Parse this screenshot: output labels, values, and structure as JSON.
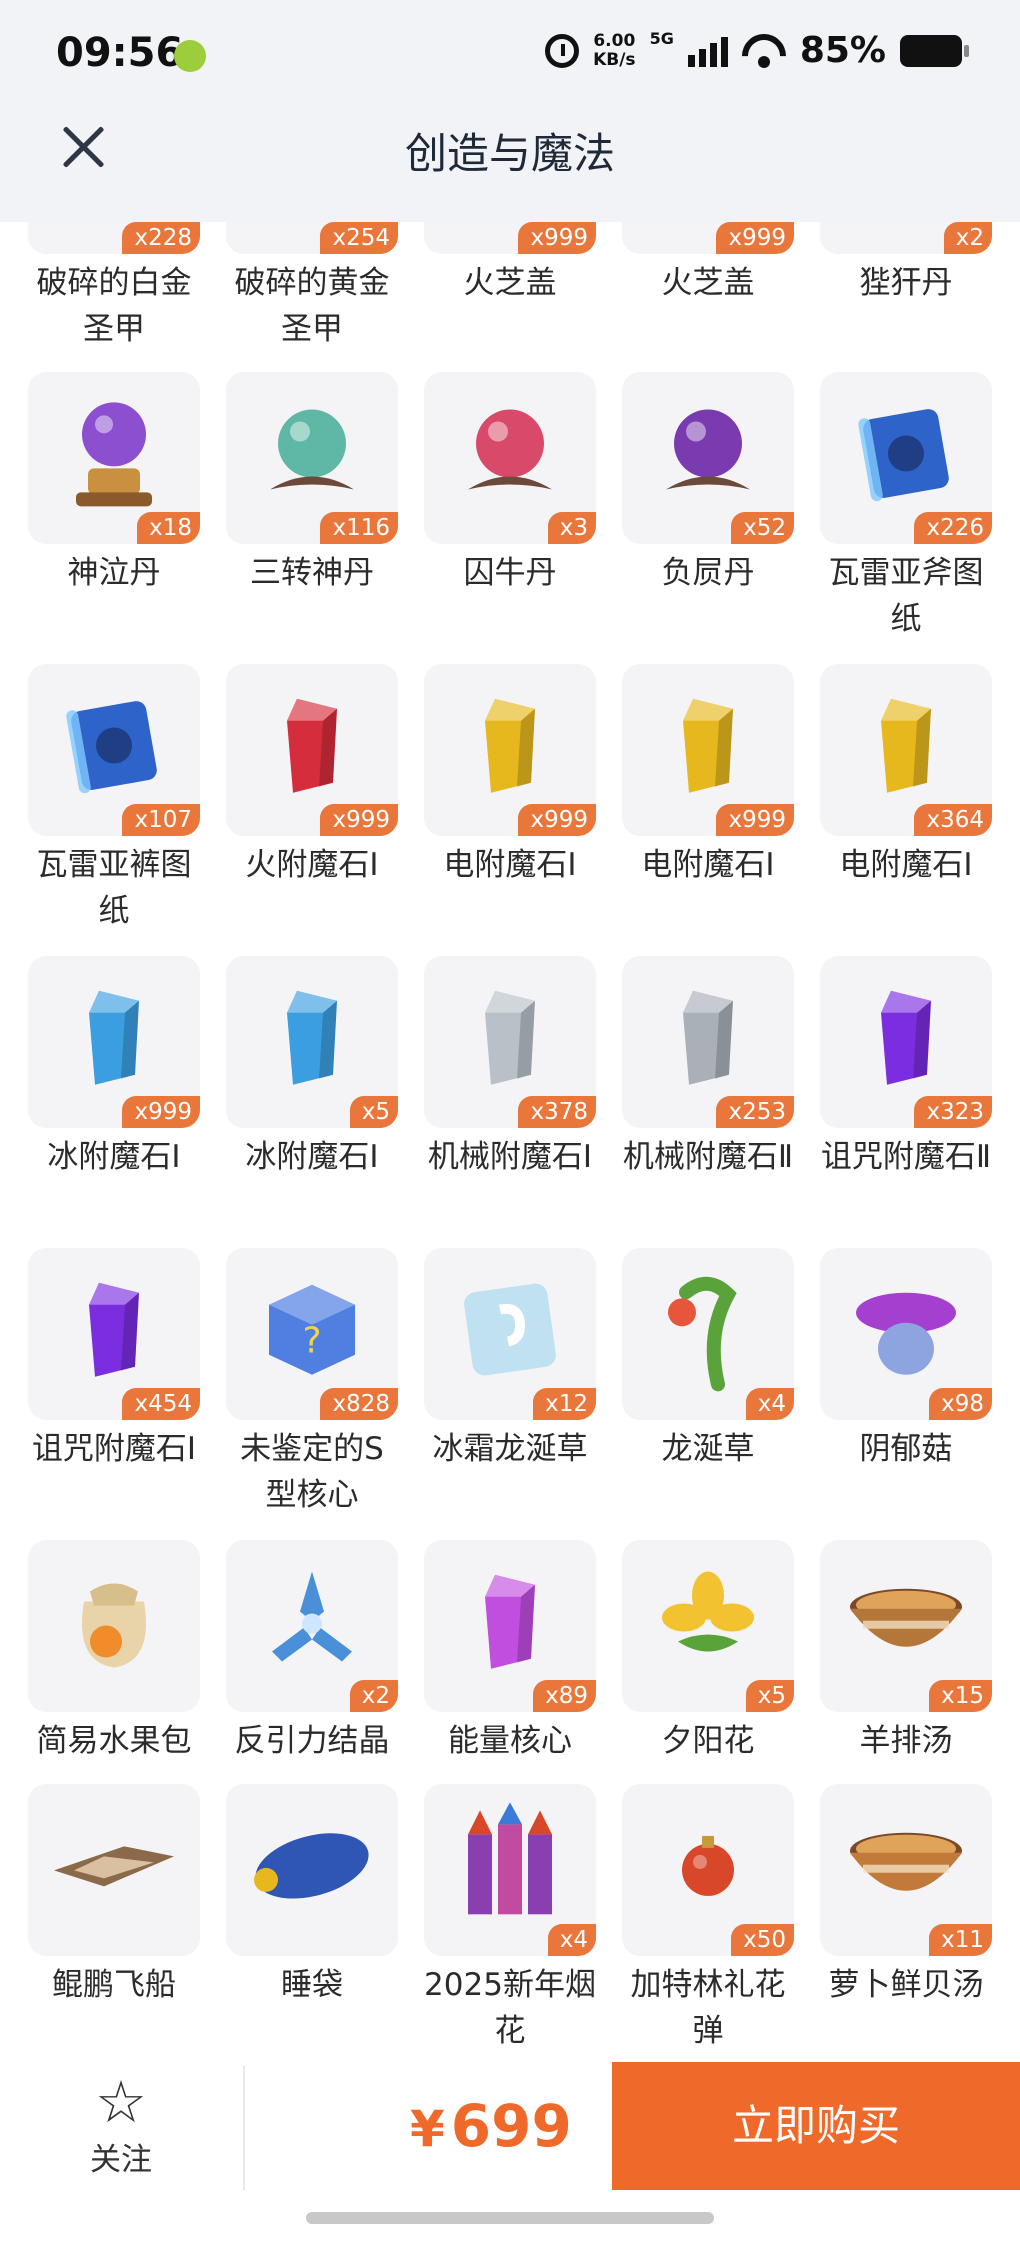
{
  "status_bar": {
    "time": "09:56",
    "speed_value": "6.00",
    "speed_unit": "KB/s",
    "network": "5G",
    "battery": "85%"
  },
  "header": {
    "title": "创造与魔法",
    "close_icon": "close-icon"
  },
  "items": [
    {
      "name": "破碎的白金圣甲",
      "count": "x228",
      "icon": "armor-icon",
      "partial": true
    },
    {
      "name": "破碎的黄金圣甲",
      "count": "x254",
      "icon": "armor-icon",
      "partial": true
    },
    {
      "name": "火芝盖",
      "count": "x999",
      "icon": "mushroom-icon",
      "partial": true
    },
    {
      "name": "火芝盖",
      "count": "x999",
      "icon": "mushroom-icon",
      "partial": true
    },
    {
      "name": "狴犴丹",
      "count": "x2",
      "icon": "pill-icon",
      "partial": true
    },
    {
      "name": "神泣丹",
      "count": "x18",
      "icon": "crystal-ball-icon",
      "color": "#8b4fd0"
    },
    {
      "name": "三转神丹",
      "count": "x116",
      "icon": "orb-icon",
      "color": "#5fb8a6"
    },
    {
      "name": "囚牛丹",
      "count": "x3",
      "icon": "orb-icon",
      "color": "#d94a6a"
    },
    {
      "name": "负屃丹",
      "count": "x52",
      "icon": "orb-icon",
      "color": "#7a3bb0"
    },
    {
      "name": "瓦雷亚斧图纸",
      "count": "x226",
      "icon": "scroll-icon",
      "color": "#2e63c9"
    },
    {
      "name": "瓦雷亚裤图纸",
      "count": "x107",
      "icon": "scroll-icon",
      "color": "#2e63c9"
    },
    {
      "name": "火附魔石Ⅰ",
      "count": "x999",
      "icon": "gem-icon",
      "color": "#d62d3c"
    },
    {
      "name": "电附魔石Ⅰ",
      "count": "x999",
      "icon": "gem-icon",
      "color": "#e6b81e"
    },
    {
      "name": "电附魔石Ⅰ",
      "count": "x999",
      "icon": "gem-icon",
      "color": "#e6b81e"
    },
    {
      "name": "电附魔石Ⅰ",
      "count": "x364",
      "icon": "gem-icon",
      "color": "#e6b81e"
    },
    {
      "name": "冰附魔石Ⅰ",
      "count": "x999",
      "icon": "gem-icon",
      "color": "#3a9ee0"
    },
    {
      "name": "冰附魔石Ⅰ",
      "count": "x5",
      "icon": "gem-icon",
      "color": "#3a9ee0"
    },
    {
      "name": "机械附魔石Ⅰ",
      "count": "x378",
      "icon": "gem-icon",
      "color": "#b9c0c8"
    },
    {
      "name": "机械附魔石Ⅱ",
      "count": "x253",
      "icon": "gem-icon",
      "color": "#a9b0b8"
    },
    {
      "name": "诅咒附魔石Ⅱ",
      "count": "x323",
      "icon": "gem-icon",
      "color": "#7b2ee0"
    },
    {
      "name": "诅咒附魔石Ⅰ",
      "count": "x454",
      "icon": "gem-icon",
      "color": "#7b2ee0"
    },
    {
      "name": "未鉴定的S型核心",
      "count": "x828",
      "icon": "mystery-box-icon",
      "color": "#4f7fe0"
    },
    {
      "name": "冰霜龙涎草",
      "count": "x12",
      "icon": "ice-block-icon",
      "color": "#bfe1f2"
    },
    {
      "name": "龙涎草",
      "count": "x4",
      "icon": "plant-icon",
      "color": "#5aa33a"
    },
    {
      "name": "阴郁菇",
      "count": "x98",
      "icon": "mushroom-icon",
      "color": "#a53fd0"
    },
    {
      "name": "简易水果包",
      "count": "",
      "icon": "bag-icon",
      "color": "#e8d4a8"
    },
    {
      "name": "反引力结晶",
      "count": "x2",
      "icon": "crystal-icon",
      "color": "#4a90d9"
    },
    {
      "name": "能量核心",
      "count": "x89",
      "icon": "gem-icon",
      "color": "#c24ee0"
    },
    {
      "name": "夕阳花",
      "count": "x5",
      "icon": "flower-icon",
      "color": "#f2c230"
    },
    {
      "name": "羊排汤",
      "count": "x15",
      "icon": "soup-icon",
      "color": "#b5763a"
    },
    {
      "name": "鲲鹏飞船",
      "count": "",
      "icon": "ship-icon",
      "color": "#8a6a4a"
    },
    {
      "name": "睡袋",
      "count": "",
      "icon": "sleeping-bag-icon",
      "color": "#2f55b5"
    },
    {
      "name": "2025新年烟花",
      "count": "x4",
      "icon": "firework-icon",
      "color": "#8a3fb0"
    },
    {
      "name": "加特林礼花弹",
      "count": "x50",
      "icon": "bomb-icon",
      "color": "#d9472a"
    },
    {
      "name": "萝卜鲜贝汤",
      "count": "x11",
      "icon": "soup-icon",
      "color": "#c27a3a"
    }
  ],
  "bottom": {
    "follow_label": "关注",
    "price_symbol": "¥",
    "price": "699",
    "buy_label": "立即购买"
  },
  "colors": {
    "accent": "#ef6a2a",
    "badge": "#e9763a"
  }
}
